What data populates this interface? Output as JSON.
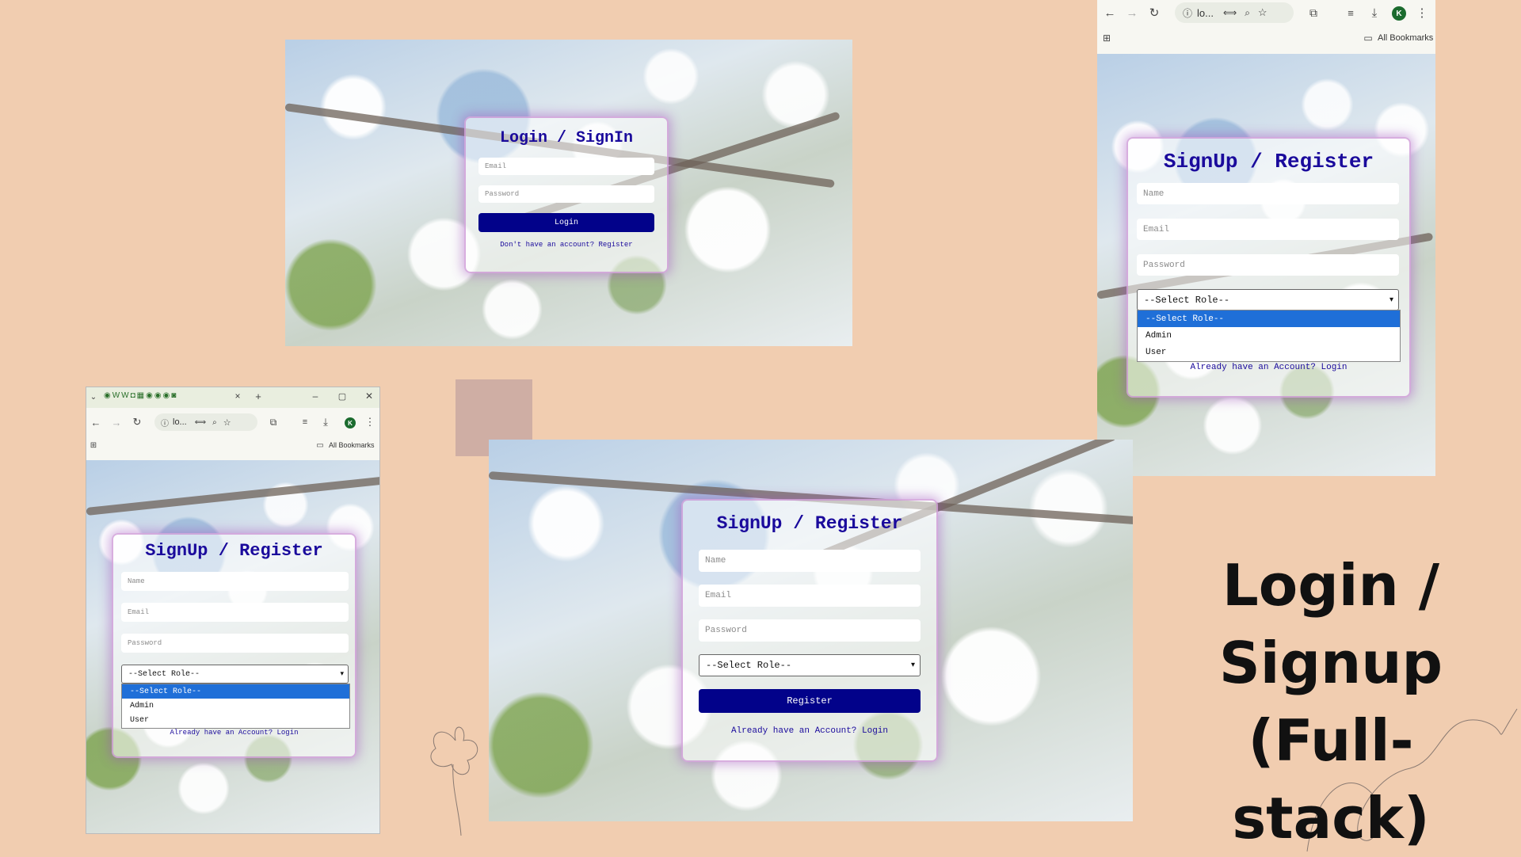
{
  "headline": {
    "line1": "Login /",
    "line2": "Signup (Full-",
    "line3": "stack)"
  },
  "login_shot": {
    "title": "Login / SignIn",
    "email_placeholder": "Email",
    "password_placeholder": "Password",
    "login_button": "Login",
    "register_link": "Don't have an account? Register"
  },
  "signup_main": {
    "title": "SignUp / Register",
    "name_placeholder": "Name",
    "email_placeholder": "Email",
    "password_placeholder": "Password",
    "role_selected": "--Select Role--",
    "register_button": "Register",
    "login_link": "Already have an Account? Login"
  },
  "signup_right": {
    "browser": {
      "address": "lo...",
      "bookmarks": "All Bookmarks",
      "profile_initial": "K"
    },
    "title": "SignUp / Register",
    "name_placeholder": "Name",
    "email_placeholder": "Email",
    "password_placeholder": "Password",
    "role_selected": "--Select Role--",
    "role_options": [
      "--Select Role--",
      "Admin",
      "User"
    ],
    "login_link": "Already have an Account? Login"
  },
  "signup_left": {
    "browser": {
      "address": "lo...",
      "bookmarks": "All Bookmarks",
      "profile_initial": "K",
      "tab_close": "×",
      "new_tab": "+"
    },
    "title": "SignUp / Register",
    "name_placeholder": "Name",
    "email_placeholder": "Email",
    "password_placeholder": "Password",
    "role_selected": "--Select Role--",
    "role_options": [
      "--Select Role--",
      "Admin",
      "User"
    ],
    "login_link": "Already have an Account? Login"
  },
  "colors": {
    "background": "#f1cdb0",
    "title_blue": "#1a0a9c",
    "button_navy": "#02028a",
    "dropdown_highlight": "#1f6fd8"
  }
}
